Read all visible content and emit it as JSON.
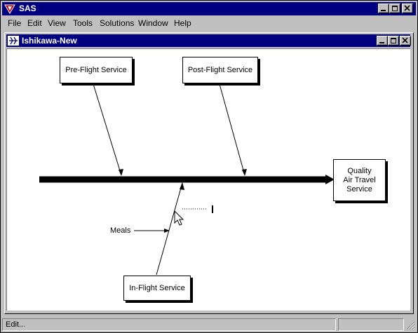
{
  "app": {
    "title": "SAS",
    "icon": "sas-logo-icon"
  },
  "menu": [
    {
      "label": "File"
    },
    {
      "label": "Edit"
    },
    {
      "label": "View"
    },
    {
      "label": "Tools"
    },
    {
      "label": "Solutions"
    },
    {
      "label": "Window"
    },
    {
      "label": "Help"
    }
  ],
  "window": {
    "title": "Ishikawa-New",
    "icon": "ishikawa-diagram-icon"
  },
  "diagram": {
    "effect": {
      "line1": "Quality",
      "line2": "Air Travel",
      "line3": "Service"
    },
    "causes": [
      {
        "label": "Pre-Flight Service"
      },
      {
        "label": "Post-Flight Service"
      },
      {
        "label": "In-Flight Service"
      }
    ],
    "sub_causes": [
      {
        "label": "Meals"
      }
    ]
  },
  "status": {
    "text": "Edit..."
  },
  "colors": {
    "title_bar": "#000080",
    "face": "#c0c0c0",
    "canvas": "#ffffff"
  }
}
